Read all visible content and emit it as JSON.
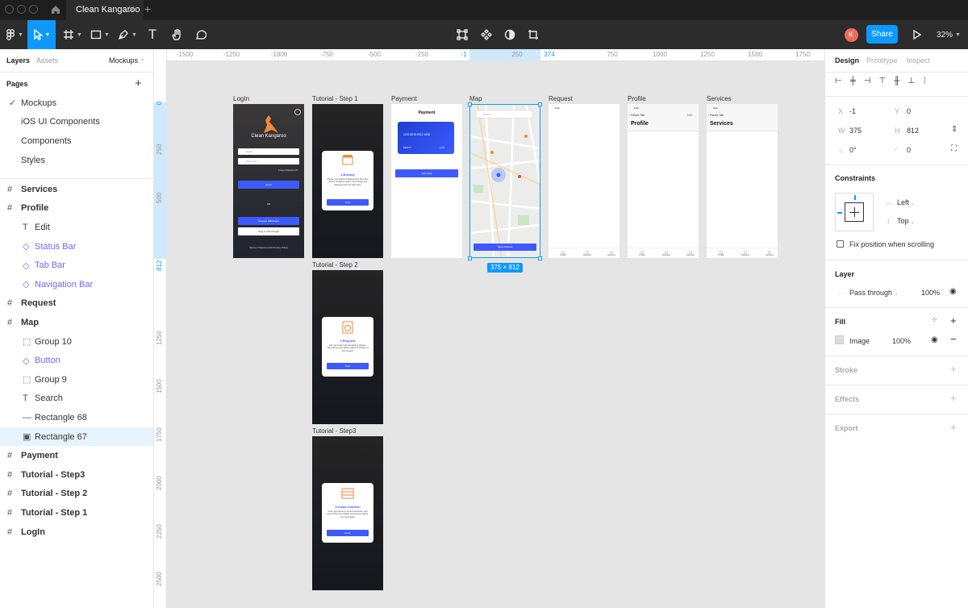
{
  "app": {
    "file_tab": "Clean Kangaroo",
    "new_tab_icon": "plus-icon"
  },
  "toolbar": {
    "zoom": "32%",
    "share_label": "Share",
    "avatar_letter": "K"
  },
  "left_panel": {
    "tabs": {
      "layers": "Layers",
      "assets": "Assets",
      "page_selector": "Mockups"
    },
    "pages_heading": "Pages",
    "pages": [
      "Mockups",
      "iOS UI Components",
      "Components",
      "Styles"
    ],
    "layers": [
      {
        "label": "Services",
        "type": "frame",
        "indent": 0
      },
      {
        "label": "Profile",
        "type": "frame",
        "indent": 0
      },
      {
        "label": "Edit",
        "type": "text",
        "indent": 1
      },
      {
        "label": "Status Bar",
        "type": "component",
        "indent": 1
      },
      {
        "label": "Tab Bar",
        "type": "component",
        "indent": 1
      },
      {
        "label": "Navigation Bar",
        "type": "component",
        "indent": 1
      },
      {
        "label": "Request",
        "type": "frame",
        "indent": 0
      },
      {
        "label": "Map",
        "type": "frame",
        "indent": 0
      },
      {
        "label": "Group 10",
        "type": "group",
        "indent": 1
      },
      {
        "label": "Button",
        "type": "component",
        "indent": 1
      },
      {
        "label": "Group 9",
        "type": "group",
        "indent": 1
      },
      {
        "label": "Search",
        "type": "text",
        "indent": 1
      },
      {
        "label": "Rectangle 68",
        "type": "line",
        "indent": 1
      },
      {
        "label": "Rectangle 67",
        "type": "image",
        "indent": 1,
        "selected": true
      },
      {
        "label": "Payment",
        "type": "frame",
        "indent": 0
      },
      {
        "label": "Tutorial - Step3",
        "type": "frame",
        "indent": 0
      },
      {
        "label": "Tutorial - Step 2",
        "type": "frame",
        "indent": 0
      },
      {
        "label": "Tutorial - Step 1",
        "type": "frame",
        "indent": 0
      },
      {
        "label": "LogIn",
        "type": "frame",
        "indent": 0
      }
    ]
  },
  "rulers": {
    "h": [
      "-1500",
      "-1250",
      "-1000",
      "-750",
      "-500",
      "-250",
      "-1",
      "250",
      "374",
      "750",
      "1000",
      "1250",
      "1500",
      "1750"
    ],
    "v": [
      "0",
      "250",
      "500",
      "812",
      "1250",
      "1500",
      "1750",
      "2000",
      "2250",
      "2500"
    ]
  },
  "frames": {
    "login": {
      "label": "LogIn",
      "app_name": "Clean Kangaroo",
      "email": "Email",
      "password": "Password",
      "forgot": "Forgot Password?",
      "login_btn": "Log In",
      "or": "OR",
      "signup_email": "Sing Up with Email",
      "signin_google": "Sing in with Google",
      "terms": "Terms of Service and Privacy Policy"
    },
    "step1": {
      "label": "Tutorial - Step 1",
      "title": "1.Browse",
      "body": "Choose your preferred local laundry store from dozens of options nearby. View ratings and pricing per item for each store.",
      "button": "Next"
    },
    "step2": {
      "label": "Tutorial - Step 2",
      "title": "2.Request",
      "body": "Add your credit card and delivery address. We'll pick up your clothes within 30 minutes of your request.",
      "button": "Next"
    },
    "step3": {
      "label": "Tutorial - Step3",
      "title": "3.Clean Clothes!",
      "body": "Once your laundry is all nice and clean, we'll drop it off at your earliest convenience right at your door! Easy!",
      "button": "Enter"
    },
    "payment": {
      "label": "Payment",
      "title": "Payment",
      "card_number": "1234 5678 9012 3456",
      "expiry": "MM/YY",
      "cvv": "CVV",
      "button": "Add Card"
    },
    "map": {
      "label": "Map",
      "search": "Search",
      "button": "Save Address",
      "size_badge": "375 × 812"
    },
    "request": {
      "label": "Request",
      "time": "9:41"
    },
    "profile": {
      "label": "Profile",
      "time": "9:41",
      "back": "Parent Title",
      "edit": "Edit",
      "title": "Profile"
    },
    "services": {
      "label": "Services",
      "time": "9:41",
      "back": "Parent Title",
      "title": "Services"
    },
    "tabbar": [
      "Profile",
      "Request",
      "Services"
    ]
  },
  "right_panel": {
    "tabs": {
      "design": "Design",
      "prototype": "Prototype",
      "inspect": "Inspect"
    },
    "x_label": "X",
    "x": "-1",
    "y_label": "Y",
    "y": "0",
    "w_label": "W",
    "w": "375",
    "h_label": "H",
    "h": "812",
    "rotation": "0°",
    "radius": "0",
    "constraints_heading": "Constraints",
    "constraint_h": "Left",
    "constraint_v": "Top",
    "fix_position": "Fix position when scrolling",
    "layer_heading": "Layer",
    "blend": "Pass through",
    "layer_opacity": "100%",
    "fill_heading": "Fill",
    "fill_type": "Image",
    "fill_opacity": "100%",
    "stroke_heading": "Stroke",
    "effects_heading": "Effects",
    "export_heading": "Export"
  },
  "colors": {
    "accent": "#0d99ff",
    "brand_blue": "#3d5afe",
    "orange": "#f28a3a",
    "component": "#7b61ff"
  }
}
